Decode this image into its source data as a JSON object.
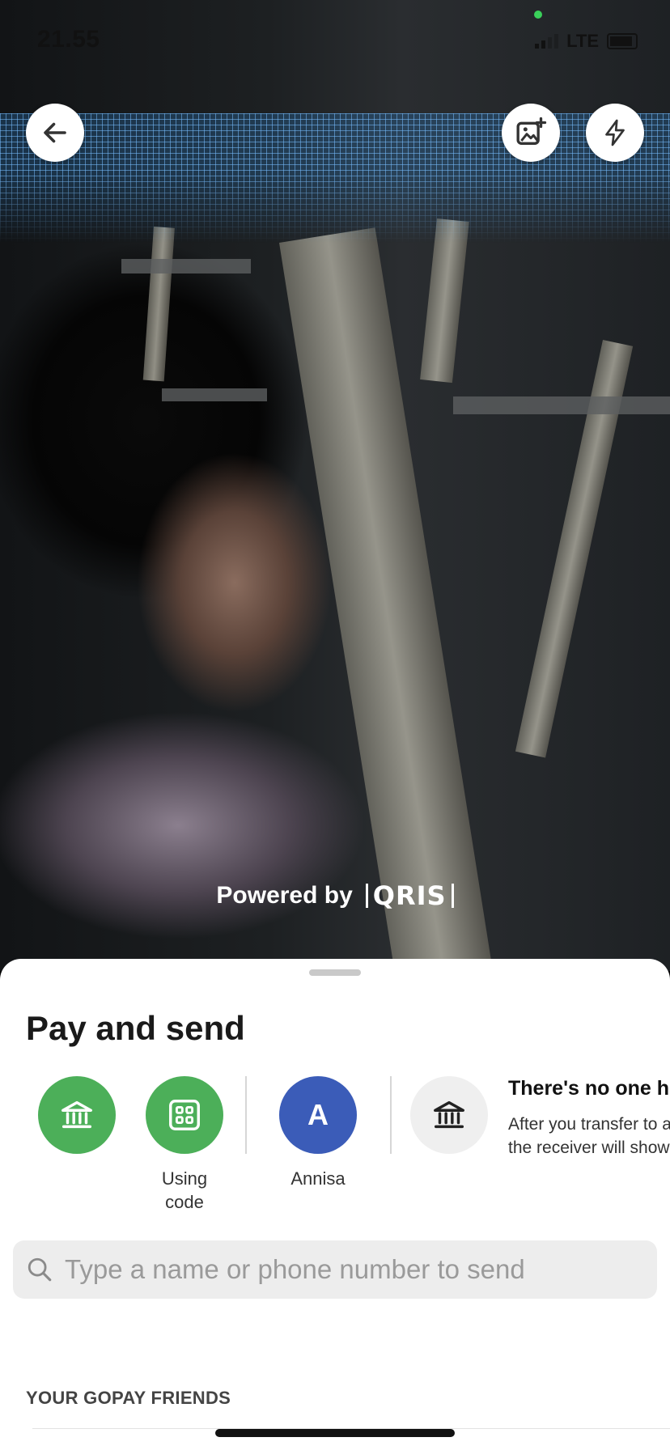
{
  "status_bar": {
    "time": "21.55",
    "network": "LTE"
  },
  "scanner": {
    "powered_by_label": "Powered by",
    "partner_logo_text": "QRIS"
  },
  "icons": {
    "back": "arrow-left-icon",
    "gallery": "gallery-add-icon",
    "flash": "flash-icon",
    "bank": "bank-icon",
    "code": "grid-code-icon",
    "search": "search-icon"
  },
  "sheet": {
    "title": "Pay and send",
    "quick_actions": [
      {
        "label": "",
        "color": "#4caf59"
      },
      {
        "label": "Using\ncode",
        "color": "#4caf59"
      },
      {
        "label": "Annisa",
        "avatar_letter": "A",
        "color": "#3b5cb8"
      }
    ],
    "empty_recent": {
      "title": "There's no one he",
      "description_line1": "After you transfer to a",
      "description_line2": "the receiver will show"
    },
    "search": {
      "placeholder": "Type a name or phone number to send",
      "value": ""
    },
    "friends_heading": "YOUR GOPAY FRIENDS"
  },
  "colors": {
    "accent_green": "#4caf59",
    "avatar_blue": "#3b5cb8",
    "sheet_bg": "#ffffff"
  }
}
